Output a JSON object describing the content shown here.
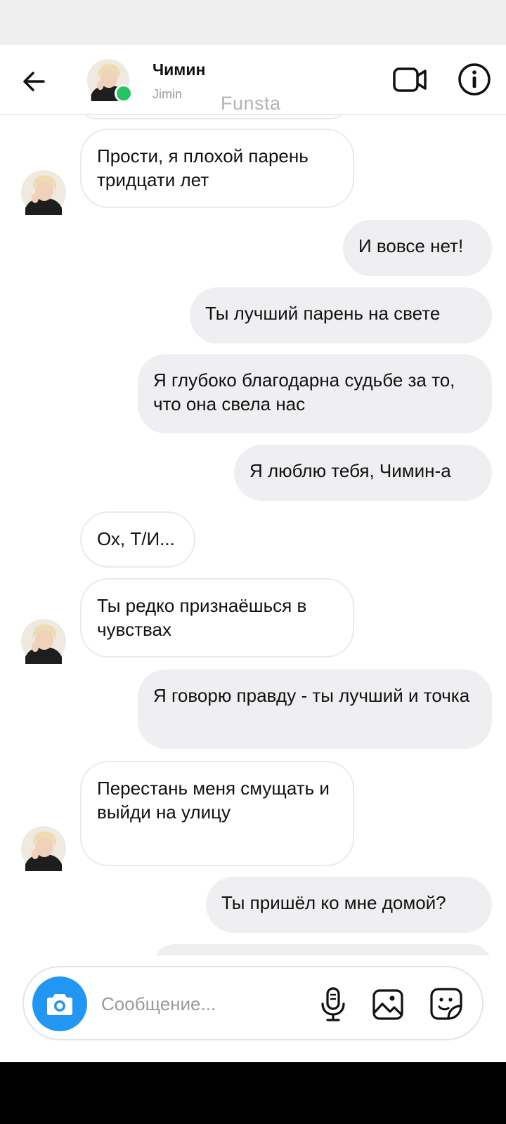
{
  "header": {
    "name": "Чимин",
    "username": "Jimin",
    "watermark": "Funsta"
  },
  "messages": [
    {
      "id": 1,
      "side": "incoming",
      "text": "Прости, я плохой парень тридцати лет"
    },
    {
      "id": 2,
      "side": "outgoing",
      "text": "И вовсе нет!"
    },
    {
      "id": 3,
      "side": "outgoing",
      "text": "Ты лучший парень на свете"
    },
    {
      "id": 4,
      "side": "outgoing",
      "text": "Я глубоко благодарна судьбе за то, что она свела нас"
    },
    {
      "id": 5,
      "side": "outgoing",
      "text": "Я люблю тебя, Чимин-а"
    },
    {
      "id": 6,
      "side": "incoming",
      "text": "Ох, Т/И..."
    },
    {
      "id": 7,
      "side": "incoming",
      "text": "Ты редко признаёшься в чувствах"
    },
    {
      "id": 8,
      "side": "outgoing",
      "text": "Я говорю правду - ты лучший и точка"
    },
    {
      "id": 9,
      "side": "incoming",
      "text": "Перестань меня смущать и выйди на улицу"
    },
    {
      "id": 10,
      "side": "outgoing",
      "text": "Ты пришёл ко мне домой?"
    }
  ],
  "composer": {
    "placeholder": "Сообщение..."
  },
  "colors": {
    "accent": "#2196f3",
    "online": "#22c55e",
    "outgoing_bubble": "#efeff2",
    "incoming_border": "#eaeaea"
  },
  "icons": [
    "back-arrow-icon",
    "video-call-icon",
    "info-icon",
    "camera-icon",
    "microphone-icon",
    "gallery-icon",
    "sticker-icon"
  ]
}
